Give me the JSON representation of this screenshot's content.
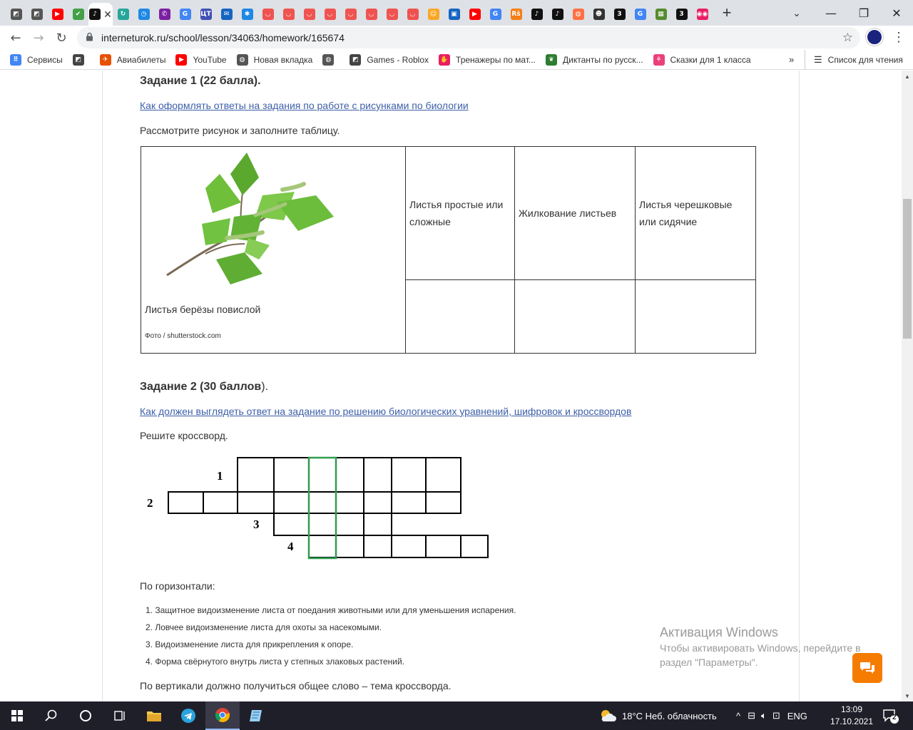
{
  "browser": {
    "tabs": [
      {
        "icon": "roblox-icon",
        "color": "#555555",
        "glyph": "◩"
      },
      {
        "icon": "roblox-icon",
        "color": "#555555",
        "glyph": "◩"
      },
      {
        "icon": "youtube-icon",
        "color": "#ff0000",
        "glyph": "▶"
      },
      {
        "icon": "leaf-icon",
        "color": "#43a047",
        "glyph": "✔"
      },
      {
        "icon": "tiktok-icon",
        "color": "#111111",
        "glyph": "♪"
      },
      {
        "icon": "refresh-icon",
        "color": "#26a69a",
        "glyph": "↻"
      },
      {
        "icon": "clock-icon",
        "color": "#1e88e5",
        "glyph": "◷"
      },
      {
        "icon": "viber-icon",
        "color": "#7b1fa2",
        "glyph": "✆"
      },
      {
        "icon": "google-icon",
        "color": "#4285f4",
        "glyph": "G"
      },
      {
        "icon": "ut-icon",
        "color": "#3f51b5",
        "glyph": "ЦТ"
      },
      {
        "icon": "mail-icon",
        "color": "#1565c0",
        "glyph": "✉"
      },
      {
        "icon": "gear-icon",
        "color": "#1e88e5",
        "glyph": "✱"
      },
      {
        "icon": "pocket-icon",
        "color": "#ef5350",
        "glyph": "◡"
      },
      {
        "icon": "pocket-icon",
        "color": "#ef5350",
        "glyph": "◡"
      },
      {
        "icon": "pocket-icon",
        "color": "#ef5350",
        "glyph": "◡"
      },
      {
        "icon": "pocket-icon",
        "color": "#ef5350",
        "glyph": "◡"
      },
      {
        "icon": "pocket-icon",
        "color": "#ef5350",
        "glyph": "◡"
      },
      {
        "icon": "pocket-icon",
        "color": "#ef5350",
        "glyph": "◡"
      },
      {
        "icon": "pocket-icon",
        "color": "#ef5350",
        "glyph": "◡"
      },
      {
        "icon": "pocket-icon",
        "color": "#ef5350",
        "glyph": "◡"
      },
      {
        "icon": "character-icon",
        "color": "#f9a825",
        "glyph": "☺"
      },
      {
        "icon": "app-icon",
        "color": "#1565c0",
        "glyph": "▣"
      },
      {
        "icon": "youtube-icon",
        "color": "#ff0000",
        "glyph": "▶"
      },
      {
        "icon": "google-icon",
        "color": "#4285f4",
        "glyph": "G"
      },
      {
        "icon": "reshak-icon",
        "color": "#f57f17",
        "glyph": "Rš"
      },
      {
        "icon": "tiktok-icon",
        "color": "#111111",
        "glyph": "♪"
      },
      {
        "icon": "tiktok-icon",
        "color": "#111111",
        "glyph": "♪"
      },
      {
        "icon": "app-icon",
        "color": "#ff7043",
        "glyph": "◍"
      },
      {
        "icon": "avatar-icon",
        "color": "#333333",
        "glyph": "☻"
      },
      {
        "icon": "three-icon",
        "color": "#111111",
        "glyph": "3"
      },
      {
        "icon": "google-icon",
        "color": "#4285f4",
        "glyph": "G"
      },
      {
        "icon": "minecraft-icon",
        "color": "#558b2f",
        "glyph": "▦"
      },
      {
        "icon": "three-icon",
        "color": "#111111",
        "glyph": "3"
      },
      {
        "icon": "eyes-icon",
        "color": "#e91e63",
        "glyph": "◉◉"
      }
    ],
    "active_tab_index": 4,
    "url": "interneturok.ru/school/lesson/34063/homework/165674",
    "bookmarks": [
      {
        "label": "Сервисы",
        "icon": "apps-icon",
        "color": "#4285f4",
        "glyph": "⠿"
      },
      {
        "label": "",
        "icon": "roblox-icon",
        "color": "#444444",
        "glyph": "◩"
      },
      {
        "label": "Авиабилеты",
        "icon": "aviasales-icon",
        "color": "#e65100",
        "glyph": "✈"
      },
      {
        "label": "YouTube",
        "icon": "youtube-icon",
        "color": "#ff0000",
        "glyph": "▶"
      },
      {
        "label": "Новая вкладка",
        "icon": "globe-icon",
        "color": "#555555",
        "glyph": "◍"
      },
      {
        "label": "",
        "icon": "globe-icon",
        "color": "#555555",
        "glyph": "◍"
      },
      {
        "label": "Games - Roblox",
        "icon": "roblox-icon",
        "color": "#444444",
        "glyph": "◩"
      },
      {
        "label": "Тренажеры по мат...",
        "icon": "hand-icon",
        "color": "#e91e63",
        "glyph": "✋"
      },
      {
        "label": "Диктанты по русск...",
        "icon": "leaf-icon",
        "color": "#2e7d32",
        "glyph": "❦"
      },
      {
        "label": "Сказки для 1 класса",
        "icon": "flamingo-icon",
        "color": "#ec407a",
        "glyph": "⚘"
      }
    ],
    "more_label": "»",
    "reading_list_label": "Список для чтения"
  },
  "page": {
    "task1": {
      "heading": "Задание 1 (22 балла).",
      "link": "Как оформлять ответы на задания по работе с рисунками по биологии",
      "instruction": "Рассмотрите рисунок и заполните таблицу.",
      "caption": "Листья берёзы повислой",
      "credit": "Фото / shutterstock.com",
      "headers": [
        "Листья простые или сложные",
        "Жилкование листьев",
        "Листья черешковые или сидячие"
      ]
    },
    "task2": {
      "heading_bold": "Задание 2 (30 баллов",
      "heading_tail": ").",
      "link": "Как должен выглядеть ответ на задание по решению биологических уравнений, шифровок и кроссвордов",
      "instruction": "Решите кроссворд.",
      "across_label": "По горизонтали:",
      "clues": [
        "1. Защитное видоизменение листа от поедания животными или для уменьшения испарения.",
        "2. Ловчее видоизменение листа для охоты за насекомыми.",
        "3. Видоизменение листа для прикрепления к опоре.",
        "4. Форма свёрнутого внутрь листа у степных злаковых растений."
      ],
      "vertical_note": "По вертикали должно получиться общее слово – тема кроссворда."
    },
    "crossword": {
      "numbers": [
        "1",
        "2",
        "3",
        "4"
      ],
      "highlight_color": "#2e9e4f",
      "row1_cells": 7,
      "row2_cells": 9,
      "row3_cells": 4,
      "row4_cells": 6
    }
  },
  "watermark": {
    "title": "Активация Windows",
    "line1": "Чтобы активировать Windows, перейдите в",
    "line2": "раздел \"Параметры\"."
  },
  "taskbar": {
    "weather": "18°C  Неб. облачность",
    "lang": "ENG",
    "time": "13:09",
    "date": "17.10.2021",
    "notifications": "2"
  }
}
